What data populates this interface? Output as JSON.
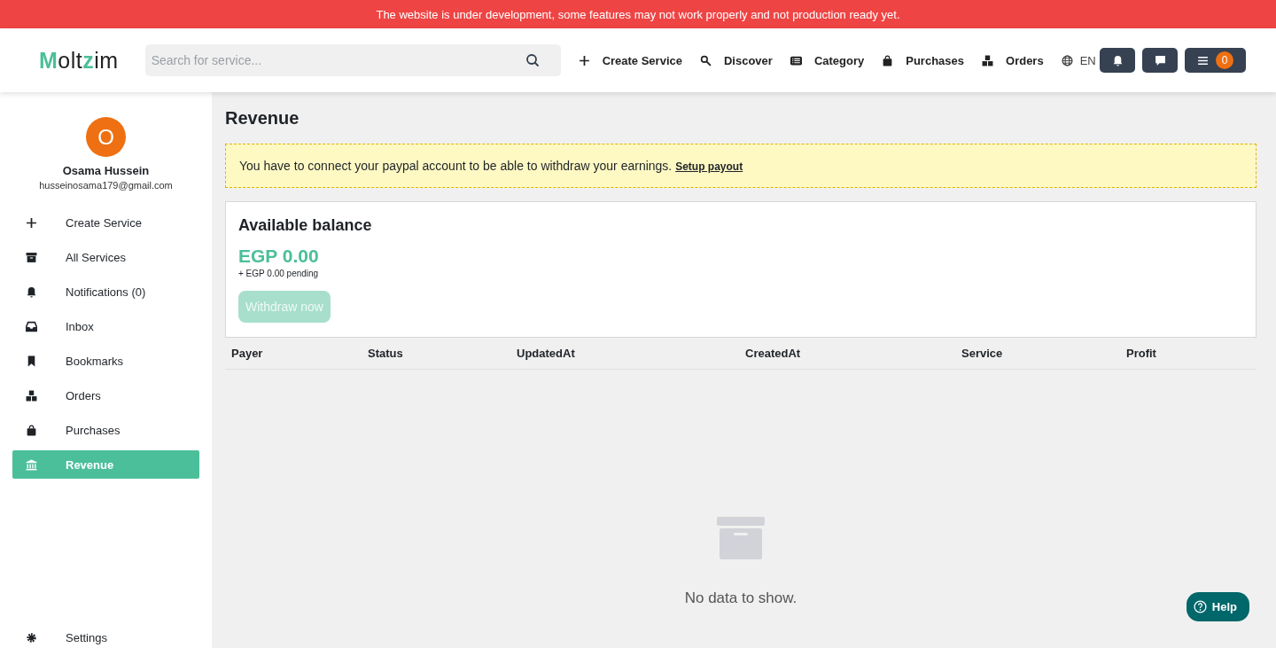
{
  "banner": {
    "text": "The website is under development, some features may not work properly and not production ready yet."
  },
  "header": {
    "logo": {
      "first": "M",
      "middle": "olt",
      "accent": "z",
      "last": "im"
    },
    "search": {
      "placeholder": "Search for service..."
    },
    "nav": [
      {
        "label": "Create Service",
        "kind": "plus"
      },
      {
        "label": "Discover",
        "kind": "discover"
      },
      {
        "label": "Category",
        "kind": "list"
      },
      {
        "label": "Purchases",
        "kind": "bag"
      },
      {
        "label": "Orders",
        "kind": "boxes"
      },
      {
        "label": "EN",
        "kind": "globe"
      }
    ],
    "menu_badge": "0"
  },
  "sidebar": {
    "avatar": "O",
    "name": "Osama Hussein",
    "email": "husseinosama179@gmail.com",
    "items": [
      {
        "label": "Create Service",
        "kind": "plus",
        "selected": false
      },
      {
        "label": "All Services",
        "kind": "archive",
        "selected": false
      },
      {
        "label": "Notifications (0)",
        "kind": "bell",
        "selected": false
      },
      {
        "label": "Inbox",
        "kind": "inbox",
        "selected": false
      },
      {
        "label": "Bookmarks",
        "kind": "bookmark",
        "selected": false
      },
      {
        "label": "Orders",
        "kind": "boxes",
        "selected": false
      },
      {
        "label": "Purchases",
        "kind": "bag",
        "selected": false
      },
      {
        "label": "Revenue",
        "kind": "bank",
        "selected": true
      }
    ],
    "footer_item": {
      "label": "Settings",
      "kind": "gear"
    }
  },
  "main": {
    "title": "Revenue",
    "alert": {
      "text": "You have to connect your paypal account to be able to withdraw your earnings.",
      "link": "Setup payout"
    },
    "balance": {
      "title": "Available balance",
      "amount": "EGP 0.00",
      "pending": "+ EGP 0.00 pending",
      "button": "Withdraw now",
      "disabled": true
    },
    "table": {
      "columns": [
        "Payer",
        "Status",
        "UpdatedAt",
        "CreatedAt",
        "Service",
        "Profit"
      ],
      "empty": "No data to show."
    }
  },
  "help": {
    "label": "Help"
  }
}
